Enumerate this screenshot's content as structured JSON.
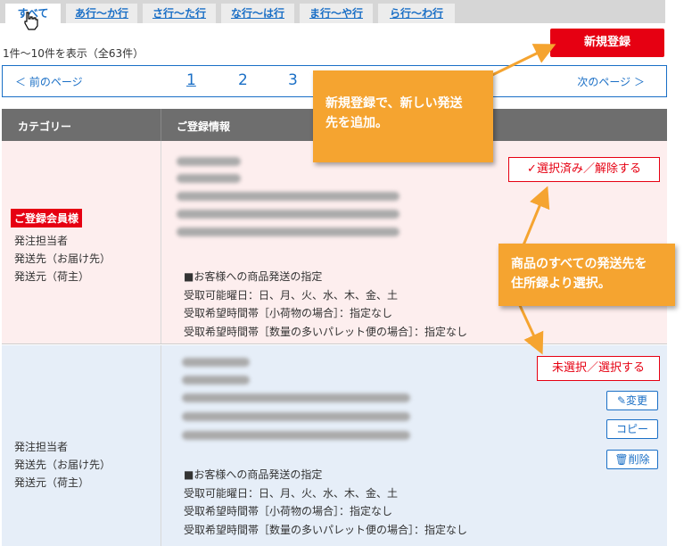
{
  "tabs": [
    {
      "label": "すべて"
    },
    {
      "label": "あ行～か行"
    },
    {
      "label": "さ行～た行"
    },
    {
      "label": "な行～は行"
    },
    {
      "label": "ま行～や行"
    },
    {
      "label": "ら行～わ行"
    }
  ],
  "result_count": "1件～10件を表示（全63件）",
  "new_button": "新規登録",
  "pager": {
    "prev": "＜ 前のページ",
    "next": "次のページ ＞",
    "pages": [
      "1",
      "2",
      "3"
    ],
    "current": "1"
  },
  "table": {
    "col_category": "カテゴリー",
    "col_info": "ご登録情報"
  },
  "rows": [
    {
      "badge": "ご登録会員様",
      "labels": [
        "発注担当者",
        "発送先（お届け先）",
        "発送元（荷主）"
      ],
      "notes": [
        "■お客様への商品発送の指定",
        "受取可能曜日：日、月、火、水、木、金、土",
        "受取希望時間帯［小荷物の場合］：指定なし",
        "受取希望時間帯［数量の多いパレット便の場合］：指定なし"
      ],
      "select_label": "✓選択済み／解除する"
    },
    {
      "labels": [
        "発注担当者",
        "発送先（お届け先）",
        "発送元（荷主）"
      ],
      "notes": [
        "■お客様への商品発送の指定",
        "受取可能曜日：日、月、火、水、木、金、土",
        "受取希望時間帯［小荷物の場合］：指定なし",
        "受取希望時間帯［数量の多いパレット便の場合］：指定なし"
      ],
      "select_label": "未選択／選択する",
      "edit_label": "変更",
      "copy_label": "コピー",
      "delete_label": "削除"
    }
  ],
  "callouts": [
    {
      "text_line1": "新規登録で、新しい発送",
      "text_line2": "先を追加。"
    },
    {
      "text_line1": "商品のすべての発送先を",
      "text_line2": "住所録より選択。"
    }
  ],
  "colors": {
    "accent_red": "#e60012",
    "link_blue": "#1a6fc6",
    "callout_orange": "#f5a430"
  }
}
